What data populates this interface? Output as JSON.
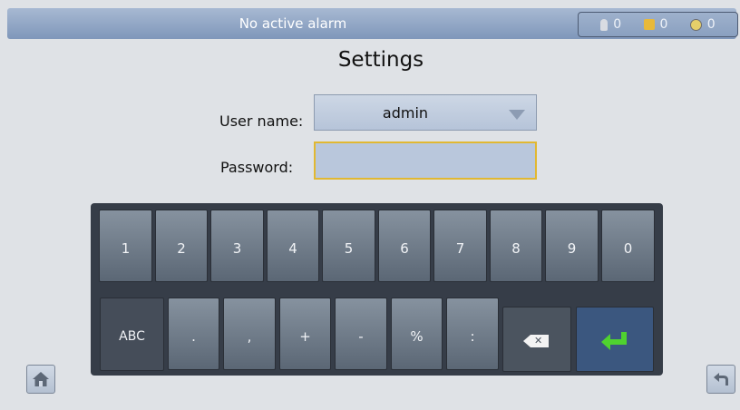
{
  "alarm_bar": {
    "status_text": "No active alarm",
    "counters": [
      {
        "icon": "minor-alarm-icon",
        "count": "0"
      },
      {
        "icon": "major-alarm-icon",
        "count": "0"
      },
      {
        "icon": "critical-alarm-icon",
        "count": "0"
      }
    ]
  },
  "page_title": "Settings",
  "form": {
    "username_label": "User name:",
    "username_value": "admin",
    "password_label": "Password:",
    "password_value": ""
  },
  "keyboard": {
    "row1": [
      "1",
      "2",
      "3",
      "4",
      "5",
      "6",
      "7",
      "8",
      "9",
      "0"
    ],
    "row2": [
      "ABC",
      ".",
      ",",
      "+",
      "-",
      "%",
      ":"
    ],
    "backspace_icon": "backspace-icon",
    "enter_icon": "enter-icon"
  },
  "nav": {
    "home_icon": "home-icon",
    "back_icon": "back-icon"
  },
  "colors": {
    "accent": "#e1b832",
    "enter_arrow": "#4fd22f",
    "topbar": "#8aa0c0"
  }
}
